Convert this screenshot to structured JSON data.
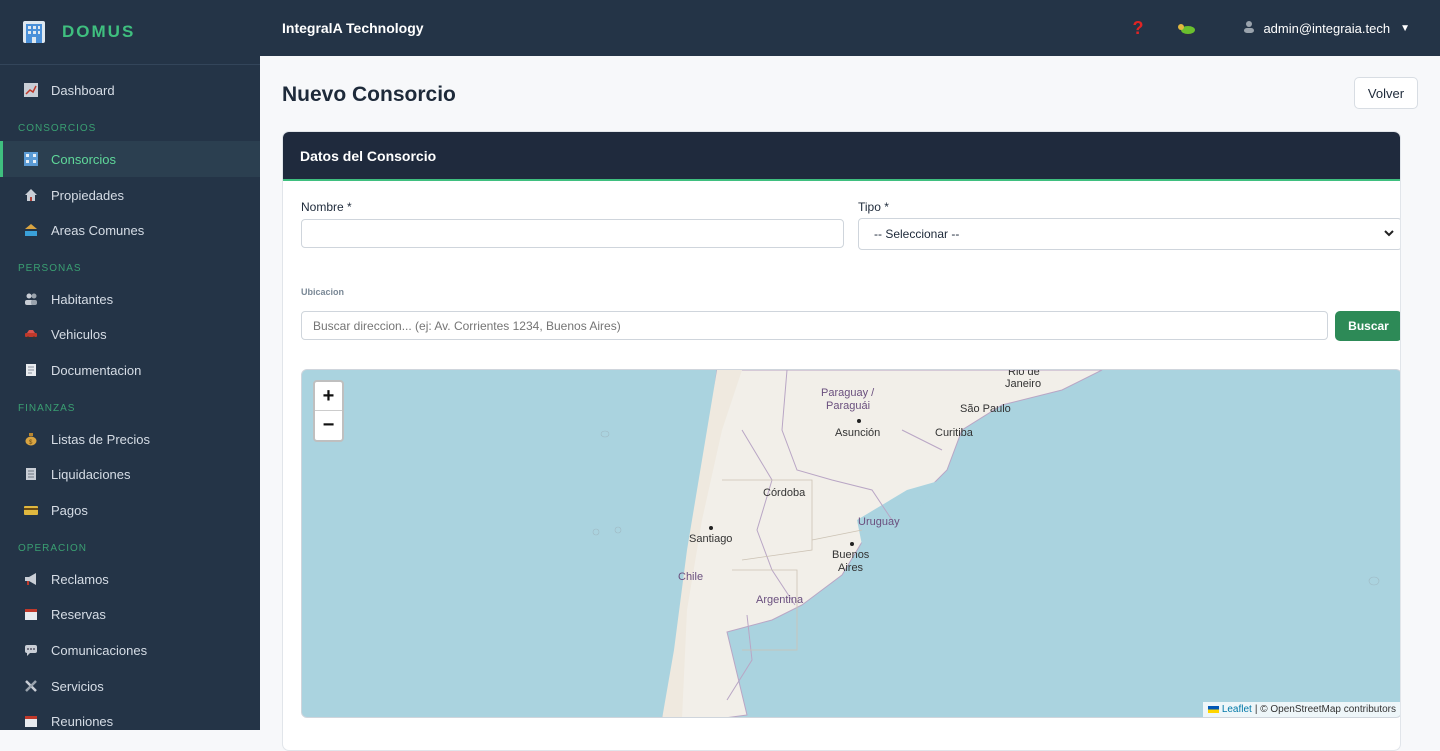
{
  "brand": {
    "name": "DOMUS"
  },
  "sidebar": {
    "items": [
      {
        "label": "Dashboard",
        "icon": "chart-icon"
      },
      {
        "label": "Consorcios",
        "icon": "building-icon"
      },
      {
        "label": "Propiedades",
        "icon": "house-icon"
      },
      {
        "label": "Areas Comunes",
        "icon": "pool-icon"
      },
      {
        "label": "Habitantes",
        "icon": "people-icon"
      },
      {
        "label": "Vehiculos",
        "icon": "car-icon"
      },
      {
        "label": "Documentacion",
        "icon": "document-icon"
      },
      {
        "label": "Listas de Precios",
        "icon": "money-bag-icon"
      },
      {
        "label": "Liquidaciones",
        "icon": "receipt-icon"
      },
      {
        "label": "Pagos",
        "icon": "card-icon"
      },
      {
        "label": "Reclamos",
        "icon": "megaphone-icon"
      },
      {
        "label": "Reservas",
        "icon": "calendar-icon"
      },
      {
        "label": "Comunicaciones",
        "icon": "chat-icon"
      },
      {
        "label": "Servicios",
        "icon": "tools-icon"
      },
      {
        "label": "Reuniones",
        "icon": "calendar-icon"
      }
    ],
    "sections": [
      "CONSORCIOS",
      "PERSONAS",
      "FINANZAS",
      "OPERACION"
    ]
  },
  "header": {
    "company": "IntegralA Technology",
    "help": "?",
    "user": "admin@integraia.tech",
    "caret": "▼"
  },
  "page": {
    "title": "Nuevo Consorcio",
    "back_label": "Volver"
  },
  "card": {
    "title": "Datos del Consorcio"
  },
  "form": {
    "nombre_label": "Nombre *",
    "nombre_value": "",
    "tipo_label": "Tipo *",
    "tipo_value": "-- Seleccionar --",
    "ubicacion_label": "Ubicacion",
    "search_placeholder": "Buscar direccion... (ej: Av. Corrientes 1234, Buenos Aires)",
    "buscar_label": "Buscar"
  },
  "map": {
    "zoom_in": "+",
    "zoom_out": "−",
    "places": [
      "Rio de Janeiro",
      "São Paulo",
      "Curitiba",
      "Paraguay / Paraguái",
      "Asunción",
      "Córdoba",
      "Uruguay",
      "Santiago",
      "Buenos Aires",
      "Chile",
      "Argentina"
    ],
    "attribution_leaflet": "Leaflet",
    "attribution_rest": " | © OpenStreetMap contributors"
  }
}
